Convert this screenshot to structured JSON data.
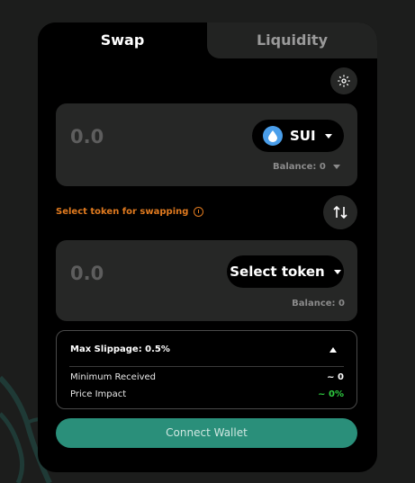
{
  "tabs": {
    "swap": "Swap",
    "liquidity": "Liquidity"
  },
  "from": {
    "amount": "0.0",
    "token": "SUI",
    "balance": "Balance: 0"
  },
  "warning": "Select token for swapping",
  "to": {
    "amount": "0.0",
    "token_label": "Select token",
    "balance": "Balance: 0"
  },
  "info": {
    "slippage": "Max Slippage: 0.5%",
    "min_received_label": "Minimum Received",
    "min_received_value": "~ 0",
    "price_impact_label": "Price Impact",
    "price_impact_value": "~ 0%"
  },
  "connect_label": "Connect Wallet",
  "colors": {
    "accent": "#2a8f7a",
    "warning": "#e07a1f",
    "positive": "#2ecc40",
    "sui": "#4a9eea"
  },
  "icons": [
    "settings-gear-icon",
    "sui-droplet-icon",
    "chevron-down-icon",
    "swap-direction-icon",
    "info-circle-icon",
    "chevron-up-icon"
  ]
}
